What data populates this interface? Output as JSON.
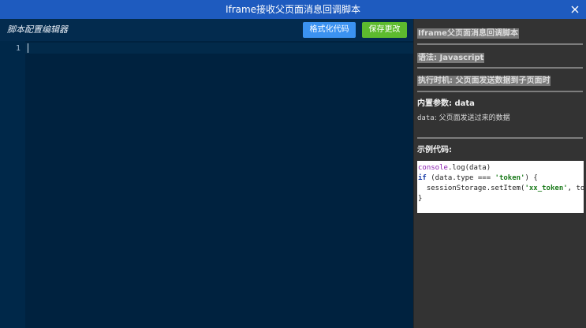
{
  "dialog": {
    "title": "Iframe接收父页面消息回调脚本",
    "close_icon": "close-icon"
  },
  "editor": {
    "title": "脚本配置编辑器",
    "format_label": "格式化代码",
    "save_label": "保存更改",
    "line_numbers": [
      "1"
    ],
    "content": ""
  },
  "help": {
    "heading": "Iframe父页面消息回调脚本",
    "syntax": "语法: Javascript",
    "timing": "执行时机: 父页面发送数据到子页面时",
    "params_title": "内置参数: data",
    "param_name": "data",
    "param_desc": ":  父页面发送过来的数据",
    "example_title": "示例代码:",
    "code": {
      "line1_a": "console",
      "line1_b": ".log(data)",
      "line2_a": "if",
      "line2_b": " (data.type === ",
      "line2_c": "'token'",
      "line2_d": ") {",
      "line3_a": "  sessionStorage.setItem(",
      "line3_b": "'xx_token'",
      "line3_c": ", token)",
      "line4": "}"
    }
  },
  "colors": {
    "titlebar": "#1e5bbf",
    "editor_bg": "#00223f",
    "format_button": "#3b92f0",
    "save_button": "#5dbb2e"
  }
}
